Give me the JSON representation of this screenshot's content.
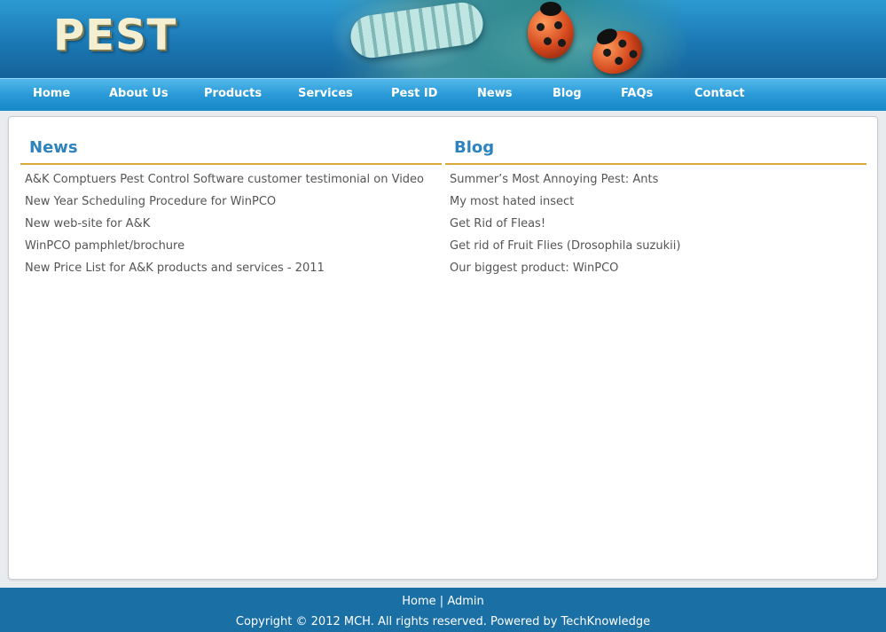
{
  "header": {
    "logo": "PEST"
  },
  "nav": {
    "items": [
      {
        "label": "Home"
      },
      {
        "label": "About Us"
      },
      {
        "label": "Products"
      },
      {
        "label": "Services"
      },
      {
        "label": "Pest ID"
      },
      {
        "label": "News"
      },
      {
        "label": "Blog"
      },
      {
        "label": "FAQs"
      },
      {
        "label": "Contact"
      }
    ]
  },
  "news": {
    "title": "News",
    "items": [
      "A&K Comptuers Pest Control Software customer testimonial on Video",
      "New Year Scheduling Procedure for WinPCO",
      "New web-site for A&K",
      "WinPCO pamphlet/brochure",
      "New Price List for A&K products and services - 2011"
    ]
  },
  "blog": {
    "title": "Blog",
    "items": [
      "Summer’s Most Annoying Pest: Ants",
      "My most hated insect",
      "Get Rid of Fleas!",
      "Get rid of Fruit Flies (Drosophila suzukii)",
      "Our biggest product: WinPCO"
    ]
  },
  "footer": {
    "home_link": "Home",
    "separator": "|",
    "admin_link": "Admin",
    "copyright": "Copyright © 2012 MCH. All rights reserved. Powered by TechKnowledge"
  },
  "colors": {
    "header_blue": "#1b78b3",
    "nav_blue": "#2a9ad8",
    "heading_blue": "#2c83bd",
    "rule_gold": "#d9a638",
    "footer_blue": "#1a6fa5",
    "logo_cream": "#f3efd0"
  }
}
